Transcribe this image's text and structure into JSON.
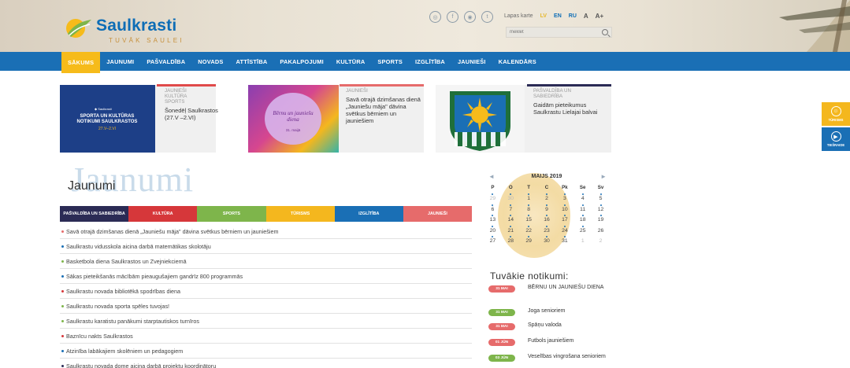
{
  "header": {
    "logo_name": "Saulkrasti",
    "logo_tagline": "TUVĀK SAULEI",
    "social_icons": [
      "circle-icon",
      "facebook-icon",
      "instagram-icon",
      "twitter-icon"
    ],
    "site_map": "Lapas karte",
    "lang_lv": "LV",
    "lang_en": "EN",
    "lang_ru": "RU",
    "font_small": "A",
    "font_large": "A+",
    "search_placeholder": "meklēt"
  },
  "nav": {
    "items": [
      {
        "label": "SĀKUMS",
        "active": true
      },
      {
        "label": "JAUNUMI"
      },
      {
        "label": "PAŠVALDĪBA"
      },
      {
        "label": "NOVADS"
      },
      {
        "label": "ATTĪSTĪBA"
      },
      {
        "label": "PAKALPOJUMI"
      },
      {
        "label": "KULTŪRA"
      },
      {
        "label": "SPORTS"
      },
      {
        "label": "IZGLĪTĪBA"
      },
      {
        "label": "JAUNIEŠI"
      },
      {
        "label": "KALENDĀRS"
      }
    ]
  },
  "cards": [
    {
      "image_text": "SPORTA UN KULTŪRAS NOTIKUMI SAULKRASTOS",
      "image_subtext": "27.V–2.VI",
      "categories": [
        "JAUNIEŠI",
        "KULTŪRA",
        "SPORTS"
      ],
      "title": "Šonedēļ Saulkrastos (27.V –2.VI)",
      "bar_color": "#e04b4b",
      "image_color": "#1d3f87"
    },
    {
      "image_text": "Bērnu un jauniešu diena",
      "image_subtext": "31. maijā",
      "categories": [
        "JAUNIEŠI"
      ],
      "title": "Savā otrajā dzimšanas dienā „Jauniešu māja\" dāvina svētkus bērniem un jauniešiem",
      "bar_color": "#e66b6b"
    },
    {
      "categories": [
        "PAŠVALDĪBA UN",
        "SABIEDRĪBA"
      ],
      "title": "Gaidām pieteikumus Saulkrastu Lielajai balvai",
      "bar_color": "#2b2b55"
    }
  ],
  "section": {
    "big_title": "Jaunumi",
    "title": "Jaunumi"
  },
  "category_tabs": [
    {
      "label": "PAŠVALDĪBA UN SABIEDRĪBA",
      "color": "#2b2b55"
    },
    {
      "label": "KULTŪRA",
      "color": "#d6373a"
    },
    {
      "label": "SPORTS",
      "color": "#7eb54b"
    },
    {
      "label": "TŪRISMS",
      "color": "#f4b71e"
    },
    {
      "label": "IZGLĪTĪBA",
      "color": "#1a6fb5"
    },
    {
      "label": "JAUNIEŠI",
      "color": "#e66b6b"
    }
  ],
  "news": [
    {
      "text": "Savā otrajā dzimšanas dienā „Jauniešu māja\" dāvina svētkus bērniem un jauniešiem",
      "dot": "#e66b6b"
    },
    {
      "text": "Saulkrastu vidusskola aicina darbā matemātikas skolotāju",
      "dot": "#1a6fb5"
    },
    {
      "text": "Basketbola diena Saulkrastos un Zvejniekciemā",
      "dot": "#7eb54b"
    },
    {
      "text": "Sākas pieteikšanās mācībām pieaugušajiem gandrīz 800 programmās",
      "dot": "#1a6fb5"
    },
    {
      "text": "Saulkrastu novada bibliotēkā spodrības diena",
      "dot": "#d6373a"
    },
    {
      "text": "Saulkrastu novada sporta spēles tuvojas!",
      "dot": "#7eb54b"
    },
    {
      "text": "Saulkrastu karatistu panākumi starptautiskos turnīros",
      "dot": "#7eb54b"
    },
    {
      "text": "Baznīcu nakts Saulkrastos",
      "dot": "#d6373a"
    },
    {
      "text": "Atzinība labākajiem skolēniem un pedagogiem",
      "dot": "#1a6fb5"
    },
    {
      "text": "Saulkrastu novada dome aicina darbā projektu koordinātoru",
      "dot": "#2b2b55"
    }
  ],
  "calendar": {
    "month": "MAIJS 2019",
    "prev": "◄",
    "next": "►",
    "dow": [
      "P",
      "O",
      "T",
      "C",
      "Pk",
      "Se",
      "Sv"
    ],
    "days": [
      {
        "d": "29",
        "muted": true,
        "ev": true
      },
      {
        "d": "30",
        "muted": true,
        "ev": true
      },
      {
        "d": "1",
        "ev": true
      },
      {
        "d": "2",
        "ev": true
      },
      {
        "d": "3",
        "ev": true
      },
      {
        "d": "4",
        "ev": true
      },
      {
        "d": "5",
        "ev": true
      },
      {
        "d": "6",
        "ev": true
      },
      {
        "d": "7",
        "ev": true
      },
      {
        "d": "8",
        "ev": true
      },
      {
        "d": "9",
        "ev": true
      },
      {
        "d": "10",
        "ev": true
      },
      {
        "d": "11",
        "ev": true
      },
      {
        "d": "12",
        "ev": true
      },
      {
        "d": "13",
        "ev": true
      },
      {
        "d": "14",
        "ev": true
      },
      {
        "d": "15",
        "ev": true
      },
      {
        "d": "16",
        "ev": true
      },
      {
        "d": "17",
        "ev": true
      },
      {
        "d": "18",
        "ev": true
      },
      {
        "d": "19",
        "ev": true
      },
      {
        "d": "20",
        "ev": true
      },
      {
        "d": "21",
        "ev": true
      },
      {
        "d": "22",
        "ev": true
      },
      {
        "d": "23",
        "ev": true
      },
      {
        "d": "24",
        "ev": true
      },
      {
        "d": "25",
        "ev": true
      },
      {
        "d": "26"
      },
      {
        "d": "27",
        "ev": true
      },
      {
        "d": "28",
        "ev": true
      },
      {
        "d": "29",
        "ev": true
      },
      {
        "d": "30",
        "ev": true
      },
      {
        "d": "31",
        "ev": true
      },
      {
        "d": "1",
        "muted": true
      },
      {
        "d": "2",
        "muted": true
      }
    ]
  },
  "upcoming": {
    "title": "Tuvākie notikumi:",
    "events": [
      {
        "date": "31 MAI",
        "title": "BĒRNU UN JAUNIEŠU DIENA",
        "color": "#e66b6b"
      },
      {
        "date": "31 MAI",
        "title": "Joga senioriem",
        "color": "#7eb54b"
      },
      {
        "date": "31 MAI",
        "title": "Spāņu valoda",
        "color": "#e66b6b"
      },
      {
        "date": "01 JŪN",
        "title": "Futbols jauniešiem",
        "color": "#e66b6b"
      },
      {
        "date": "03 JŪN",
        "title": "Veselības vingrošana senioriem",
        "color": "#7eb54b"
      }
    ]
  },
  "side_tools": [
    {
      "label": "TŪRISMS",
      "icon": "tourism-icon",
      "color": "#f4b71e"
    },
    {
      "label": "TIEŠRAIDE",
      "icon": "broadcast-icon",
      "color": "#1a6fb5"
    }
  ]
}
